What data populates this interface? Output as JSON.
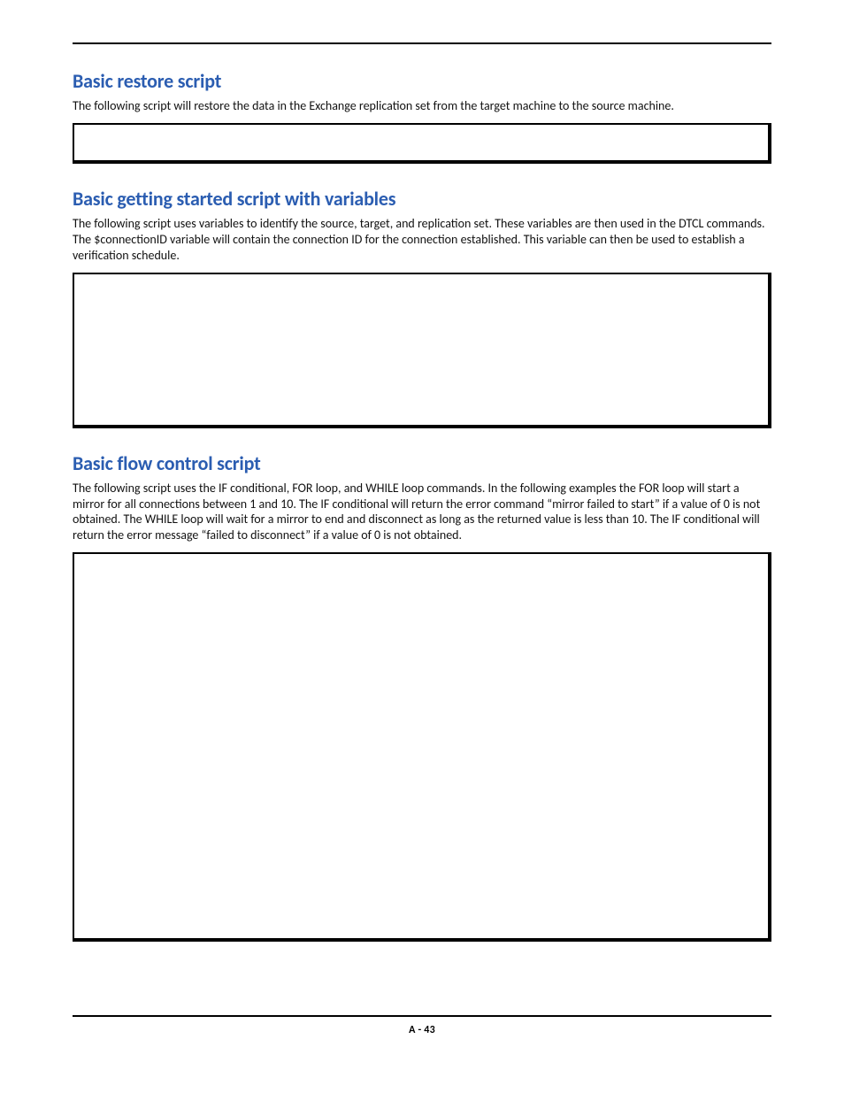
{
  "sections": [
    {
      "heading": "Basic restore script",
      "body": "The following script will restore the data in the Exchange replication set from the target machine to the source machine."
    },
    {
      "heading": "Basic getting started script with variables",
      "body": "The following script uses variables to identify the source, target, and replication set.  These variables are then used in the DTCL commands.  The $connectionID variable will contain the connection ID for the connection established. This variable can then be used to establish a verification schedule."
    },
    {
      "heading": "Basic flow control script",
      "body": "The following script uses the IF conditional, FOR loop, and WHILE loop commands.  In the following examples the FOR loop will start a mirror for all connections between 1 and 10.  The IF conditional will return the error command “mirror failed to start” if a value of 0 is not obtained.  The WHILE loop will wait for a mirror to end and disconnect as long as the returned value is less than 10.  The IF conditional will return the error message “failed to disconnect” if a value of 0 is not obtained."
    }
  ],
  "footer": {
    "page_label": "A - 43"
  }
}
